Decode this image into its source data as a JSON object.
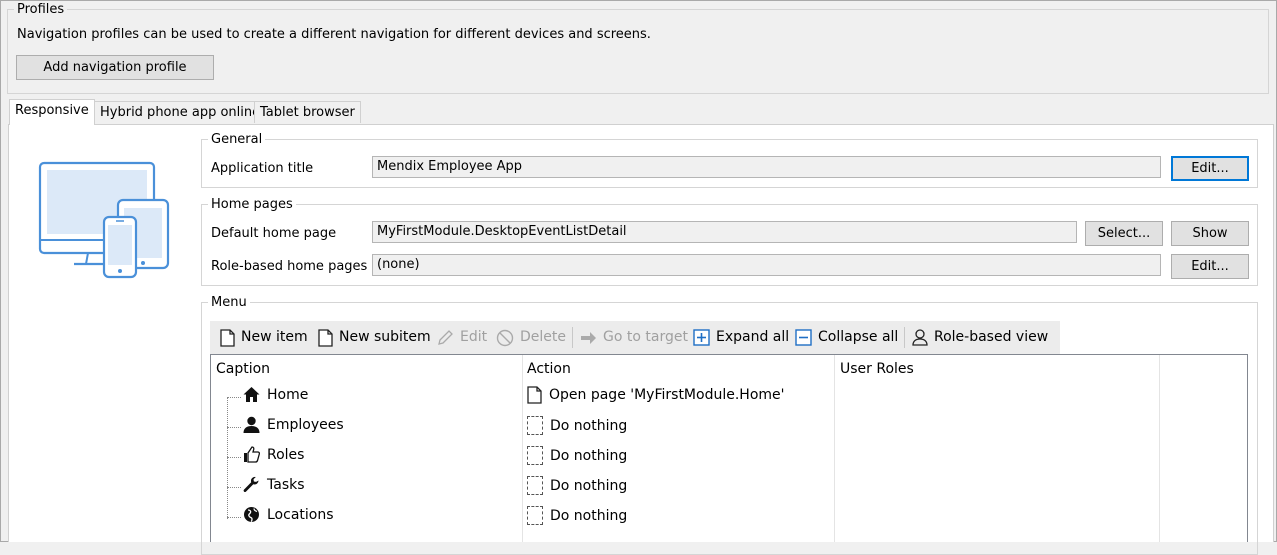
{
  "profiles": {
    "legend": "Profiles",
    "description": "Navigation profiles can be used to create a different navigation for different devices and screens.",
    "add_button": "Add navigation profile"
  },
  "tabs": [
    {
      "label": "Responsive",
      "active": true
    },
    {
      "label": "Hybrid phone app online",
      "active": false
    },
    {
      "label": "Tablet browser",
      "active": false
    }
  ],
  "device_icon": "responsive-devices-icon",
  "general": {
    "legend": "General",
    "app_title_label": "Application title",
    "app_title_value": "Mendix Employee App",
    "edit_button": "Edit..."
  },
  "home_pages": {
    "legend": "Home pages",
    "default_label": "Default home page",
    "default_value": "MyFirstModule.DesktopEventListDetail",
    "select_button": "Select...",
    "show_button": "Show",
    "role_label": "Role-based home pages",
    "role_value": "(none)",
    "edit_button": "Edit..."
  },
  "menu": {
    "legend": "Menu",
    "toolbar": {
      "new_item": "New item",
      "new_subitem": "New subitem",
      "edit": "Edit",
      "delete": "Delete",
      "go_to_target": "Go to target",
      "expand_all": "Expand all",
      "collapse_all": "Collapse all",
      "role_based_view": "Role-based view"
    },
    "columns": [
      "Caption",
      "Action",
      "User Roles"
    ],
    "items": [
      {
        "caption": "Home",
        "icon": "home-icon",
        "action": "Open page 'MyFirstModule.Home'",
        "action_icon": "page-icon",
        "roles": ""
      },
      {
        "caption": "Employees",
        "icon": "user-icon",
        "action": "Do nothing",
        "action_icon": "nothing-icon",
        "roles": ""
      },
      {
        "caption": "Roles",
        "icon": "thumbs-up-icon",
        "action": "Do nothing",
        "action_icon": "nothing-icon",
        "roles": ""
      },
      {
        "caption": "Tasks",
        "icon": "wrench-icon",
        "action": "Do nothing",
        "action_icon": "nothing-icon",
        "roles": ""
      },
      {
        "caption": "Locations",
        "icon": "globe-icon",
        "action": "Do nothing",
        "action_icon": "nothing-icon",
        "roles": ""
      }
    ]
  },
  "colors": {
    "accent": "#0078d7",
    "device_blue": "#4a90d9"
  }
}
